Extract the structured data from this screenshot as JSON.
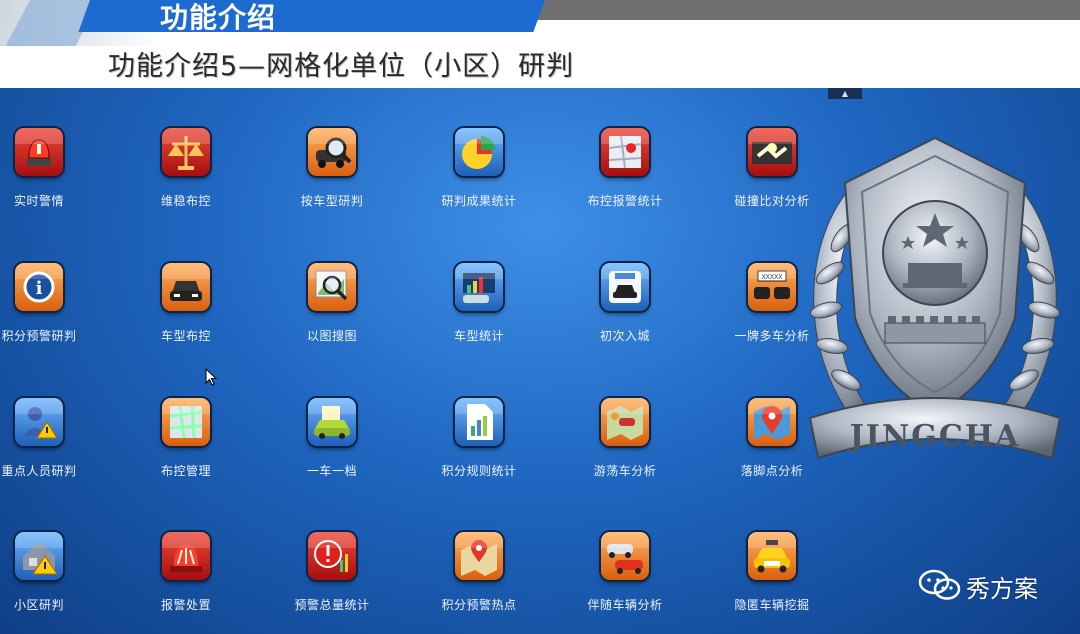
{
  "header": {
    "section_title": "功能介绍",
    "subtitle": "功能介绍5—网格化单位（小区）研判"
  },
  "collapse_toggle": "▲",
  "emblem": {
    "banner_text": "JINGCHA"
  },
  "colors": {
    "panel_blue": "#1f66c0",
    "icon_red": "#c41c1c",
    "icon_orange": "#e8731a",
    "icon_blue": "#2a7fd4"
  },
  "tiles": [
    {
      "label": "实时警情",
      "icon": "alarm-siren-icon",
      "style": "red"
    },
    {
      "label": "维稳布控",
      "icon": "scales-icon",
      "style": "red"
    },
    {
      "label": "按车型研判",
      "icon": "car-magnifier-icon",
      "style": "orange"
    },
    {
      "label": "研判成果统计",
      "icon": "pie-chart-icon",
      "style": "blue"
    },
    {
      "label": "布控报警统计",
      "icon": "map-alert-icon",
      "style": "red"
    },
    {
      "label": "碰撞比对分析",
      "icon": "car-collision-icon",
      "style": "red"
    },
    {
      "label": "积分预警研判",
      "icon": "info-badge-icon",
      "style": "orange"
    },
    {
      "label": "车型布控",
      "icon": "car-front-icon",
      "style": "orange"
    },
    {
      "label": "以图搜图",
      "icon": "image-search-icon",
      "style": "orange"
    },
    {
      "label": "车型统计",
      "icon": "car-chart-icon",
      "style": "blue"
    },
    {
      "label": "初次入城",
      "icon": "city-entry-car-icon",
      "style": "blue"
    },
    {
      "label": "一牌多车分析",
      "icon": "plate-multi-car-icon",
      "style": "orange"
    },
    {
      "label": "重点人员研判",
      "icon": "person-warning-icon",
      "style": "blue"
    },
    {
      "label": "布控管理",
      "icon": "map-grid-icon",
      "style": "orange"
    },
    {
      "label": "一车一档",
      "icon": "car-file-icon",
      "style": "blue"
    },
    {
      "label": "积分规则统计",
      "icon": "document-chart-icon",
      "style": "blue"
    },
    {
      "label": "游荡车分析",
      "icon": "map-car-icon",
      "style": "orange"
    },
    {
      "label": "落脚点分析",
      "icon": "map-pin-icon",
      "style": "orange"
    },
    {
      "label": "小区研判",
      "icon": "community-warning-icon",
      "style": "blue"
    },
    {
      "label": "报警处置",
      "icon": "police-light-icon",
      "style": "red"
    },
    {
      "label": "预警总量统计",
      "icon": "alert-bar-icon",
      "style": "red"
    },
    {
      "label": "积分预警热点",
      "icon": "map-hotspot-icon",
      "style": "orange"
    },
    {
      "label": "伴随车辆分析",
      "icon": "two-cars-icon",
      "style": "orange"
    },
    {
      "label": "隐匿车辆挖掘",
      "icon": "taxi-icon",
      "style": "orange"
    }
  ],
  "watermark": {
    "text": "秀方案",
    "icon": "wechat-icon"
  }
}
